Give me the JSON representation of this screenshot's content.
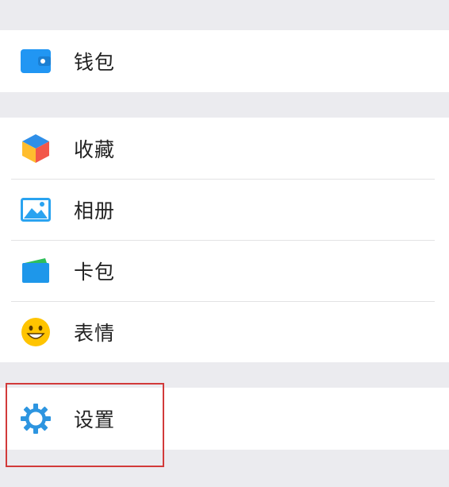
{
  "menu": {
    "wallet": {
      "label": "钱包",
      "icon": "wallet-icon"
    },
    "favorites": {
      "label": "收藏",
      "icon": "cube-icon"
    },
    "album": {
      "label": "相册",
      "icon": "picture-icon"
    },
    "cards": {
      "label": "卡包",
      "icon": "card-icon"
    },
    "stickers": {
      "label": "表情",
      "icon": "smiley-icon"
    },
    "settings": {
      "label": "设置",
      "icon": "gear-icon"
    }
  },
  "colors": {
    "background": "#ebebef",
    "group_background": "#ffffff",
    "wallet_blue": "#2196f3",
    "settings_blue": "#2d95e0",
    "smiley_yellow": "#ffc400",
    "highlight_red": "#d23a3a"
  }
}
